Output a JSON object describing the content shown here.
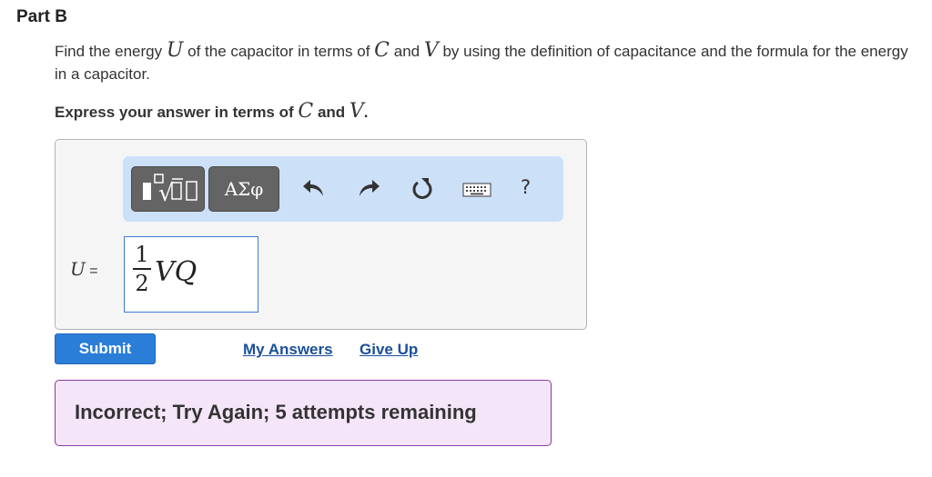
{
  "part": {
    "title": "Part B"
  },
  "question": {
    "text_1": "Find the energy ",
    "var_energy": "U",
    "text_2": " of the capacitor in terms of ",
    "var_capacitance": "C",
    "text_3": " and ",
    "var_voltage": "V",
    "text_4": " by using the definition of capacitance and the formula for the energy in a capacitor."
  },
  "instruction": {
    "text_1": "Express your answer in terms of ",
    "var_1": "C",
    "text_2": " and ",
    "var_2": "V",
    "text_3": "."
  },
  "toolbar": {
    "templates_icon": "math-templates-icon",
    "greek_label": "ΑΣφ",
    "undo_icon": "undo-icon",
    "redo_icon": "redo-icon",
    "reset_icon": "reset-icon",
    "keyboard_icon": "keyboard-icon",
    "help_label": "?"
  },
  "answer": {
    "variable": "U",
    "equals": " =",
    "numerator": "1",
    "denominator": "2",
    "expression": "VQ"
  },
  "actions": {
    "submit_label": "Submit",
    "my_answers_label": "My Answers",
    "give_up_label": "Give Up"
  },
  "feedback": {
    "message": "Incorrect; Try Again; 5 attempts remaining"
  },
  "colors": {
    "submit_bg": "#2a7ed8",
    "toolbar_bg": "#cce0f7",
    "feedback_bg": "#f5e5f8",
    "feedback_border": "#8a3aa0",
    "link": "#1a4f9c"
  }
}
